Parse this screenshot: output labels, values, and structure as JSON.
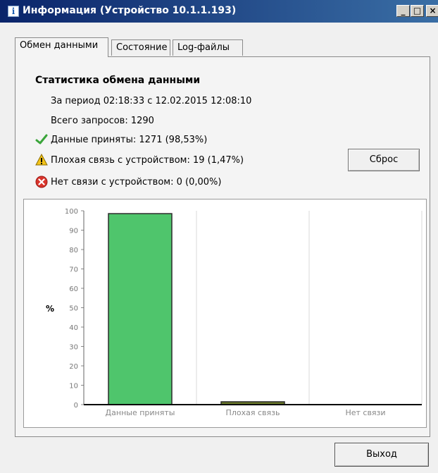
{
  "window": {
    "title": "Информация (Устройство 10.1.1.193)",
    "controls": {
      "minimize": "_",
      "maximize": "□",
      "close": "×"
    }
  },
  "tabs": [
    {
      "label": "Обмен данными",
      "active": true
    },
    {
      "label": "Состояние",
      "active": false
    },
    {
      "label": "Log-файлы",
      "active": false
    }
  ],
  "stats": {
    "title": "Статистика обмена данными",
    "period": "За период 02:18:33 с 12.02.2015 12:08:10",
    "total": "Всего запросов: 1290",
    "received": "Данные приняты: 1271 (98,53%)",
    "bad": "Плохая связь с устройством: 19 (1,47%)",
    "none": "Нет связи с устройством: 0 (0,00%)"
  },
  "icons": {
    "received": "check-icon",
    "bad": "warning-icon",
    "none": "error-icon"
  },
  "buttons": {
    "reset": "Сброс",
    "exit": "Выход"
  },
  "colors": {
    "bar_received": "#4fc56c",
    "bar_bad": "#6b7a2a",
    "title_bar": "#0a246a"
  },
  "chart_data": {
    "type": "bar",
    "ylabel": "%",
    "ylim": [
      0,
      100
    ],
    "yticks": [
      0,
      10,
      20,
      30,
      40,
      50,
      60,
      70,
      80,
      90,
      100
    ],
    "categories": [
      "Данные приняты",
      "Плохая связь",
      "Нет связи"
    ],
    "values": [
      98.53,
      1.47,
      0
    ],
    "grid": true
  }
}
